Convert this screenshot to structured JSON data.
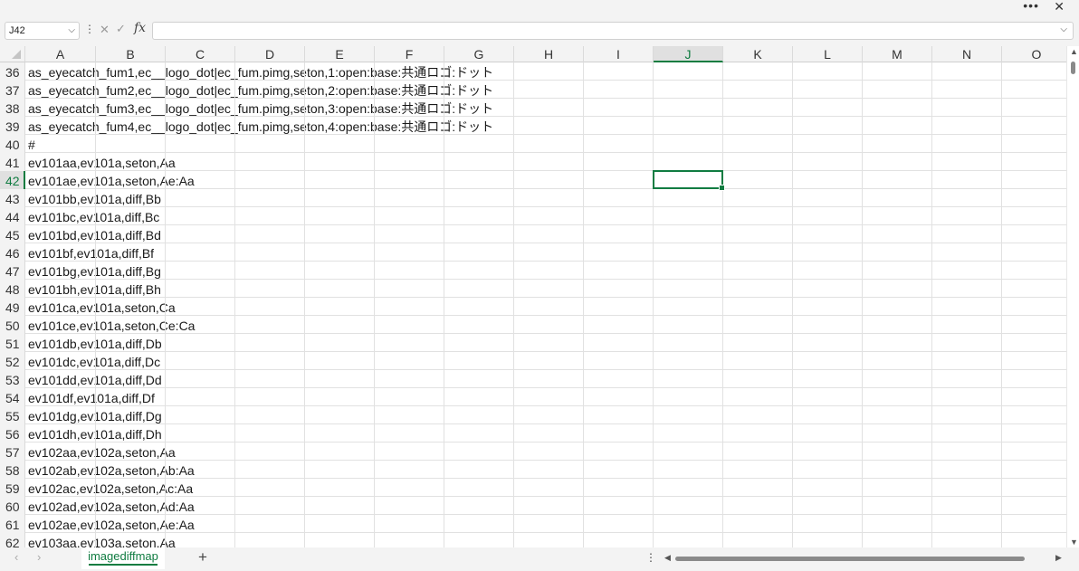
{
  "window": {
    "more_icon": "more-horizontal-icon",
    "close_icon": "close-icon"
  },
  "formula_bar": {
    "name_box": "J42",
    "fx_label": "fx",
    "formula_value": ""
  },
  "columns": [
    "A",
    "B",
    "C",
    "D",
    "E",
    "F",
    "G",
    "H",
    "I",
    "J",
    "K",
    "L",
    "M",
    "N",
    "O"
  ],
  "selected_column": "J",
  "selected_row": "42",
  "rows": [
    {
      "num": "36",
      "a": "as_eyecatch_fum1,ec__logo_dot|ec_fum.pimg,seton,1:open:base:共通ロゴ:ドット"
    },
    {
      "num": "37",
      "a": "as_eyecatch_fum2,ec__logo_dot|ec_fum.pimg,seton,2:open:base:共通ロゴ:ドット"
    },
    {
      "num": "38",
      "a": "as_eyecatch_fum3,ec__logo_dot|ec_fum.pimg,seton,3:open:base:共通ロゴ:ドット"
    },
    {
      "num": "39",
      "a": "as_eyecatch_fum4,ec__logo_dot|ec_fum.pimg,seton,4:open:base:共通ロゴ:ドット"
    },
    {
      "num": "40",
      "a": "#"
    },
    {
      "num": "41",
      "a": "ev101aa,ev101a,seton,Aa"
    },
    {
      "num": "42",
      "a": "ev101ae,ev101a,seton,Ae:Aa"
    },
    {
      "num": "43",
      "a": "ev101bb,ev101a,diff,Bb"
    },
    {
      "num": "44",
      "a": "ev101bc,ev101a,diff,Bc"
    },
    {
      "num": "45",
      "a": "ev101bd,ev101a,diff,Bd"
    },
    {
      "num": "46",
      "a": "ev101bf,ev101a,diff,Bf"
    },
    {
      "num": "47",
      "a": "ev101bg,ev101a,diff,Bg"
    },
    {
      "num": "48",
      "a": "ev101bh,ev101a,diff,Bh"
    },
    {
      "num": "49",
      "a": "ev101ca,ev101a,seton,Ca"
    },
    {
      "num": "50",
      "a": "ev101ce,ev101a,seton,Ce:Ca"
    },
    {
      "num": "51",
      "a": "ev101db,ev101a,diff,Db"
    },
    {
      "num": "52",
      "a": "ev101dc,ev101a,diff,Dc"
    },
    {
      "num": "53",
      "a": "ev101dd,ev101a,diff,Dd"
    },
    {
      "num": "54",
      "a": "ev101df,ev101a,diff,Df"
    },
    {
      "num": "55",
      "a": "ev101dg,ev101a,diff,Dg"
    },
    {
      "num": "56",
      "a": "ev101dh,ev101a,diff,Dh"
    },
    {
      "num": "57",
      "a": "ev102aa,ev102a,seton,Aa"
    },
    {
      "num": "58",
      "a": "ev102ab,ev102a,seton,Ab:Aa"
    },
    {
      "num": "59",
      "a": "ev102ac,ev102a,seton,Ac:Aa"
    },
    {
      "num": "60",
      "a": "ev102ad,ev102a,seton,Ad:Aa"
    },
    {
      "num": "61",
      "a": "ev102ae,ev102a,seton,Ae:Aa"
    },
    {
      "num": "62",
      "a": "ev103aa,ev103a,seton,Aa"
    }
  ],
  "sheet_tabs": [
    {
      "label": "imagediffmap",
      "active": true
    }
  ],
  "colors": {
    "accent": "#107c41"
  }
}
